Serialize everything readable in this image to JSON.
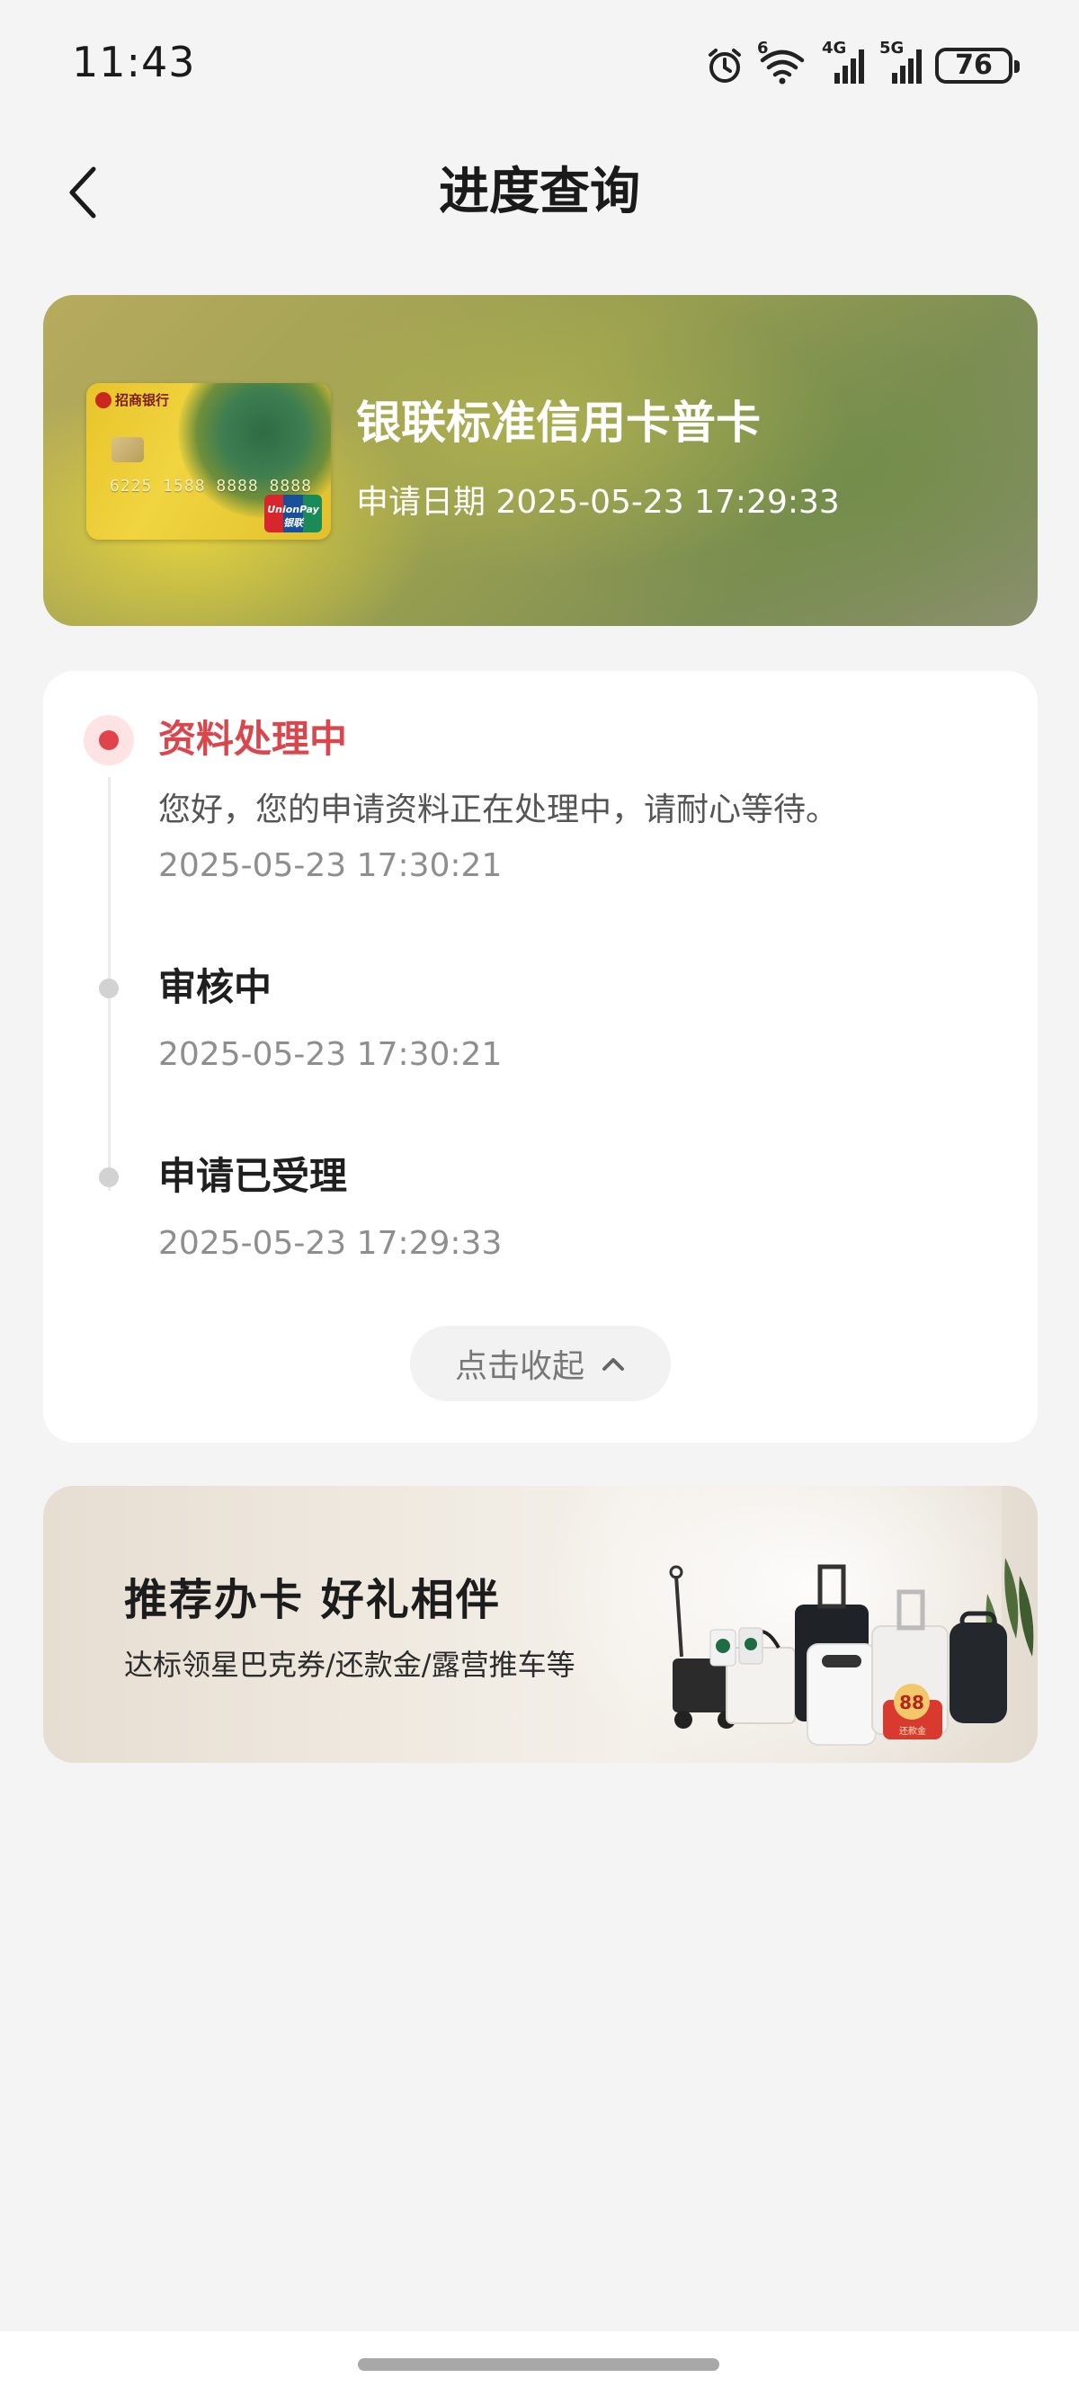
{
  "status_bar": {
    "time": "11:43",
    "battery": "76",
    "wifi_label": "6",
    "signal_1_label": "4G",
    "signal_2_label": "5G",
    "icons": [
      "alarm-icon",
      "wifi-icon",
      "signal-4g-icon",
      "signal-5g-icon",
      "battery-icon"
    ]
  },
  "nav": {
    "title": "进度查询",
    "back_icon": "chevron-left-icon"
  },
  "card": {
    "name": "银联标准信用卡普卡",
    "date_label": "申请日期",
    "date_value": "2025-05-23 17:29:33",
    "image": {
      "bank": "招商银行",
      "number": "6225 1588 8888 8888",
      "network": "UnionPay 银联"
    }
  },
  "progress": {
    "steps": [
      {
        "title": "资料处理中",
        "description": "您好，您的申请资料正在处理中，请耐心等待。",
        "time": "2025-05-23 17:30:21",
        "active": true
      },
      {
        "title": "审核中",
        "time": "2025-05-23 17:30:21",
        "active": false
      },
      {
        "title": "申请已受理",
        "time": "2025-05-23 17:29:33",
        "active": false
      }
    ],
    "collapse_label": "点击收起",
    "collapse_icon": "chevron-up-icon"
  },
  "promo": {
    "title": "推荐办卡 好礼相伴",
    "subtitle": "达标领星巴克券/还款金/露营推车等",
    "badge_amount": "88",
    "badge_label": "还款金"
  },
  "colors": {
    "background": "#f4f4f4",
    "accent_red": "#d9474d",
    "active_dot": "#e0434a",
    "inactive_dot": "#d2d2d2",
    "card_text": "#ffffff"
  }
}
